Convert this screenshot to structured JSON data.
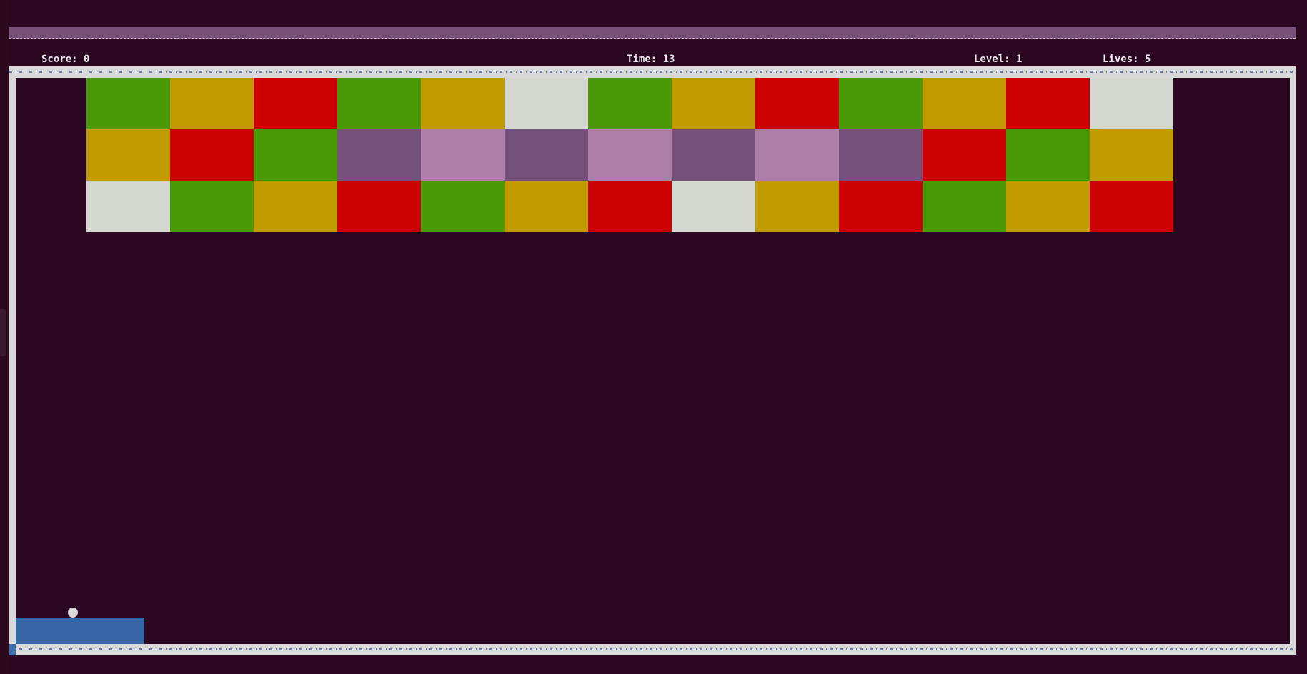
{
  "hud": {
    "score_label": "Score: ",
    "score": "0",
    "time_label": "Time: ",
    "time": "13",
    "level_label": "Level: ",
    "level": "1",
    "lives_label": "Lives: ",
    "lives": "5"
  },
  "colors": {
    "background": "#2c0722",
    "green": "#4a9a08",
    "yellow": "#c19c00",
    "red": "#cc0000",
    "white": "#d3d7cf",
    "purple": "#75507b",
    "pink": "#ad7fa8",
    "paddle": "#3666a6",
    "ball": "#d9d9d9"
  },
  "bricks": {
    "rows": [
      [
        "green",
        "yellow",
        "red",
        "green",
        "yellow",
        "white",
        "green",
        "yellow",
        "red",
        "green",
        "yellow",
        "red",
        "white"
      ],
      [
        "yellow",
        "red",
        "green",
        "purple",
        "pink",
        "purple",
        "pink",
        "purple",
        "pink",
        "purple",
        "red",
        "green",
        "yellow"
      ],
      [
        "white",
        "green",
        "yellow",
        "red",
        "green",
        "yellow",
        "red",
        "white",
        "yellow",
        "red",
        "green",
        "yellow",
        "red"
      ]
    ]
  }
}
